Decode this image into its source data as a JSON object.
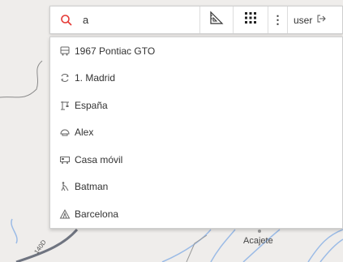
{
  "search": {
    "value": "a"
  },
  "toolbar": {
    "ruler_icon": "ruler-icon",
    "grid_icon": "apps-grid-icon",
    "more_label": "⋮",
    "user_label": "user",
    "logout_icon": "logout-icon"
  },
  "results": [
    {
      "icon": "bus-icon",
      "label": "1967 Pontiac GTO"
    },
    {
      "icon": "recycle-icon",
      "label": "1. Madrid"
    },
    {
      "icon": "crane-icon",
      "label": "España"
    },
    {
      "icon": "helmet-icon",
      "label": "Alex"
    },
    {
      "icon": "camper-icon",
      "label": "Casa móvil"
    },
    {
      "icon": "walker-icon",
      "label": "Batman"
    },
    {
      "icon": "tent-icon",
      "label": "Barcelona"
    }
  ],
  "map": {
    "place_label": "Acajete",
    "road_label": "140D"
  },
  "colors": {
    "search_icon": "#e53935",
    "road_blue": "#9bbbe6",
    "highway": "#6f7480"
  }
}
